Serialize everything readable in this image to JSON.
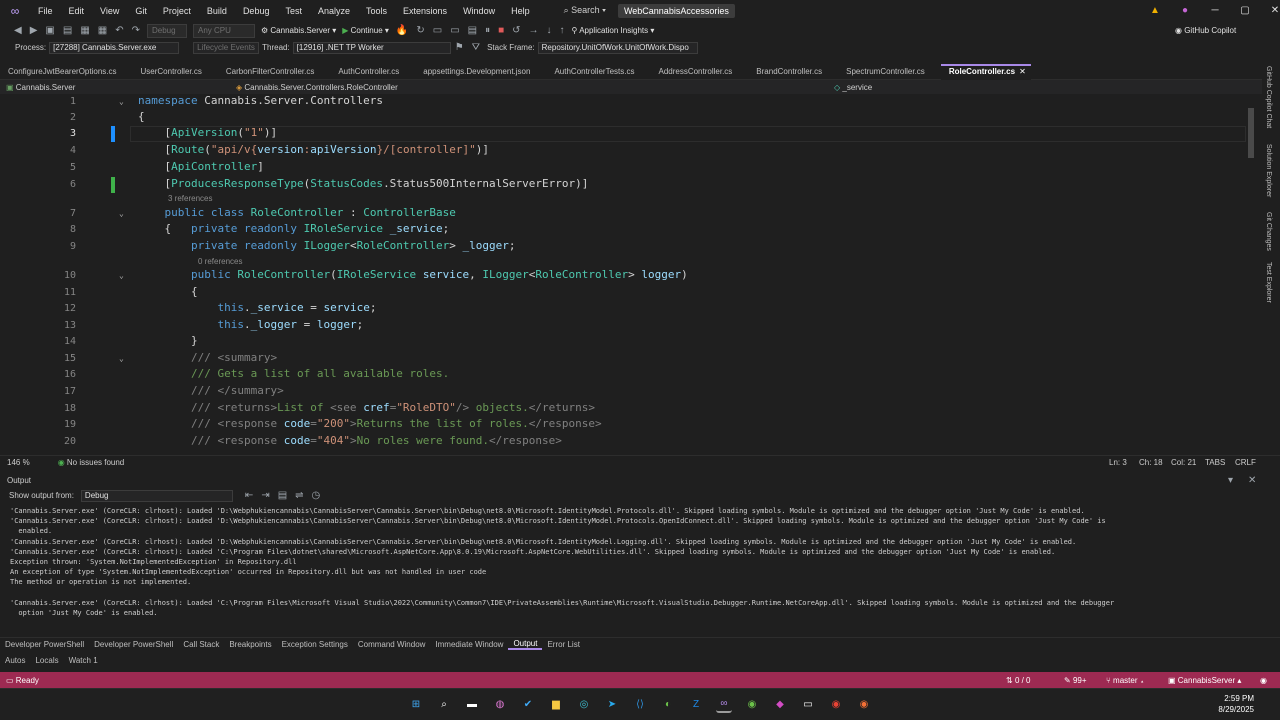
{
  "menu": {
    "items": [
      "File",
      "Edit",
      "View",
      "Git",
      "Project",
      "Build",
      "Debug",
      "Test",
      "Analyze",
      "Tools",
      "Extensions",
      "Window",
      "Help"
    ],
    "search": "Search",
    "solution": "WebCannabisAccessories"
  },
  "toolbar": {
    "config": "Debug",
    "platform": "Any CPU",
    "startup": "Cannabis.Server",
    "continue": "Continue",
    "app_insights": "Application Insights",
    "copilot": "GitHub Copilot"
  },
  "debugbar": {
    "process_label": "Process:",
    "process": "[27288] Cannabis.Server.exe",
    "lifecycle": "Lifecycle Events",
    "thread_label": "Thread:",
    "thread": "[12916] .NET TP Worker",
    "stack_label": "Stack Frame:",
    "stack": "Repository.UnitOfWork.UnitOfWork.Dispo"
  },
  "tabs": [
    {
      "label": "ConfigureJwtBearerOptions.cs",
      "active": false
    },
    {
      "label": "UserController.cs",
      "active": false
    },
    {
      "label": "CarbonFilterController.cs",
      "active": false
    },
    {
      "label": "AuthController.cs",
      "active": false
    },
    {
      "label": "appsettings.Development.json",
      "active": false
    },
    {
      "label": "AuthControllerTests.cs",
      "active": false
    },
    {
      "label": "AddressController.cs",
      "active": false
    },
    {
      "label": "BrandController.cs",
      "active": false
    },
    {
      "label": "SpectrumController.cs",
      "active": false
    },
    {
      "label": "RoleController.cs",
      "active": true
    }
  ],
  "navbar": {
    "project": "Cannabis.Server",
    "type": "Cannabis.Server.Controllers.RoleController",
    "member": "_service"
  },
  "code": {
    "refs_3": "3 references",
    "refs_0": "0 references",
    "lines": [
      "1",
      "2",
      "3",
      "4",
      "5",
      "6",
      "7",
      "8",
      "9",
      "10",
      "11",
      "12",
      "13",
      "14",
      "15",
      "16",
      "17",
      "18",
      "19",
      "20"
    ]
  },
  "editor_status": {
    "zoom": "146 %",
    "issues": "No issues found",
    "ln": "Ln: 3",
    "ch": "Ch: 18",
    "col": "Col: 21",
    "tabs": "TABS",
    "eol": "CRLF"
  },
  "output": {
    "title": "Output",
    "show_from_label": "Show output from:",
    "show_from": "Debug",
    "lines": [
      "'Cannabis.Server.exe' (CoreCLR: clrhost): Loaded 'D:\\Webphukiencannabis\\CannabisServer\\Cannabis.Server\\bin\\Debug\\net8.0\\Microsoft.IdentityModel.Protocols.dll'. Skipped loading symbols. Module is optimized and the debugger option 'Just My Code' is enabled.",
      "'Cannabis.Server.exe' (CoreCLR: clrhost): Loaded 'D:\\Webphukiencannabis\\CannabisServer\\Cannabis.Server\\bin\\Debug\\net8.0\\Microsoft.IdentityModel.Protocols.OpenIdConnect.dll'. Skipped loading symbols. Module is optimized and the debugger option 'Just My Code' is",
      "  enabled.",
      "'Cannabis.Server.exe' (CoreCLR: clrhost): Loaded 'D:\\Webphukiencannabis\\CannabisServer\\Cannabis.Server\\bin\\Debug\\net8.0\\Microsoft.IdentityModel.Logging.dll'. Skipped loading symbols. Module is optimized and the debugger option 'Just My Code' is enabled.",
      "'Cannabis.Server.exe' (CoreCLR: clrhost): Loaded 'C:\\Program Files\\dotnet\\shared\\Microsoft.AspNetCore.App\\8.0.19\\Microsoft.AspNetCore.WebUtilities.dll'. Skipped loading symbols. Module is optimized and the debugger option 'Just My Code' is enabled.",
      "Exception thrown: 'System.NotImplementedException' in Repository.dll",
      "An exception of type 'System.NotImplementedException' occurred in Repository.dll but was not handled in user code",
      "The method or operation is not implemented.",
      "",
      "'Cannabis.Server.exe' (CoreCLR: clrhost): Loaded 'C:\\Program Files\\Microsoft Visual Studio\\2022\\Community\\Common7\\IDE\\PrivateAssemblies\\Runtime\\Microsoft.VisualStudio.Debugger.Runtime.NetCoreApp.dll'. Skipped loading symbols. Module is optimized and the debugger",
      "  option 'Just My Code' is enabled."
    ]
  },
  "tool_tabs": [
    "Developer PowerShell",
    "Developer PowerShell",
    "Call Stack",
    "Breakpoints",
    "Exception Settings",
    "Command Window",
    "Immediate Window",
    "Output",
    "Error List"
  ],
  "tool_tabs_active": "Output",
  "tool_tabs2": [
    "Autos",
    "Locals",
    "Watch 1"
  ],
  "status": {
    "ready": "Ready",
    "changes": "0 / 0",
    "commits": "99+",
    "branch": "master",
    "repo": "CannabisServer",
    "color": "#9d2a52"
  },
  "taskbar": {
    "time": "2:59 PM",
    "date": "8/29/2025"
  },
  "side_tabs": [
    "GitHub Copilot Chat",
    "Solution Explorer",
    "Git Changes",
    "Test Explorer"
  ]
}
